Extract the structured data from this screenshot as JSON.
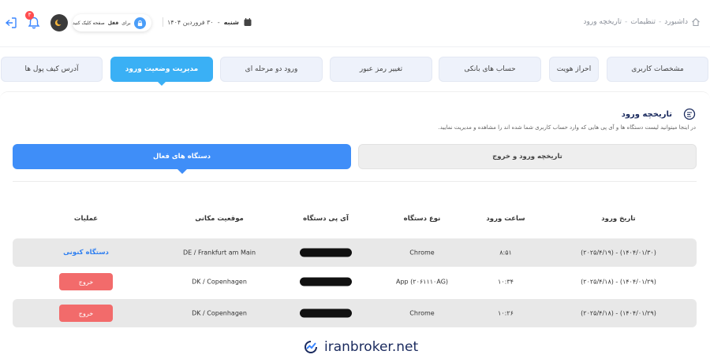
{
  "breadcrumb": {
    "items": [
      "داشبورد",
      "تنظیمات",
      "تاریخچه ورود"
    ],
    "separator": "-"
  },
  "header": {
    "day": "شنبه",
    "date": "۳۰ فروردین ۱۴۰۴",
    "date_dash": "-",
    "lock_prefix": "برای",
    "lock_bold": "قفل",
    "lock_suffix": "صفحه کلیک کنید",
    "notification_count": "۳"
  },
  "tabs": [
    {
      "label": "مشخصات کاربری"
    },
    {
      "label": "احراز هویت"
    },
    {
      "label": "حساب های بانکی"
    },
    {
      "label": "تغییر رمز عبور"
    },
    {
      "label": "ورود دو مرحله ای"
    },
    {
      "label": "مدیریت وضعیت ورود"
    },
    {
      "label": "آدرس کیف پول ها"
    }
  ],
  "active_tab": "مدیریت وضعیت ورود",
  "section": {
    "title": "تاریخچه ورود",
    "description": "در اینجا میتوانید لیست دستگاه ها و آی پی هایی که وارد حساب کاربری شما شده اند را مشاهده و مدیریت نمایید."
  },
  "segments": {
    "history_label": "تاریخچه ورود و خروج",
    "active_label": "دستگاه های فعال"
  },
  "table": {
    "columns": [
      "تاریخ ورود",
      "ساعت ورود",
      "نوع دستگاه",
      "آی پی دستگاه",
      "موقعیت مکانی",
      "عملیات"
    ],
    "rows": [
      {
        "date": "(۲۰۲۵/۴/۱۹) - (۱۴۰۴/۰۱/۳۰)",
        "time": "۸:۵۱",
        "device": "Chrome",
        "location": "DE / Frankfurt am Main",
        "action": "دستگاه کنونی"
      },
      {
        "date": "(۲۰۲۵/۴/۱۸) - (۱۴۰۴/۰۱/۲۹)",
        "time": "۱۰:۳۴",
        "device": "App (۲۰۶۱۱۱۰AG)",
        "location": "DK / Copenhagen",
        "action": "خروج"
      },
      {
        "date": "(۲۰۲۵/۴/۱۸) - (۱۴۰۴/۰۱/۲۹)",
        "time": "۱۰:۲۶",
        "device": "Chrome",
        "location": "DK / Copenhagen",
        "action": "خروج"
      }
    ]
  },
  "watermark": "iranbroker.net",
  "colors": {
    "accent": "#3ab0f5",
    "primary": "#3f8ef8",
    "danger": "#f26b6b",
    "title": "#1a2a5e"
  }
}
